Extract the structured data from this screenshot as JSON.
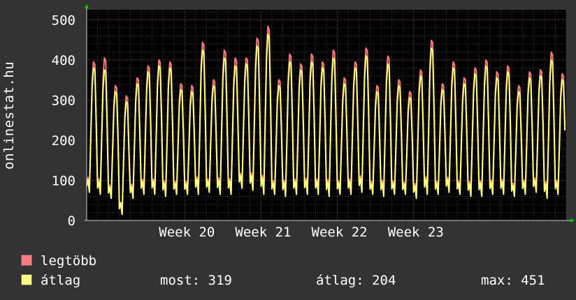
{
  "colors": {
    "background": "#333333",
    "canvas": "#000000",
    "grid_minor": "#3a3a3a",
    "grid_major": "#5a2a2a",
    "arrow": "#00cc00",
    "text": "#ffffff"
  },
  "vertical_label": "onlinestat.hu",
  "chart_data": {
    "type": "line",
    "title": "",
    "xlabel": "",
    "ylabel": "onlinestat.hu",
    "ylim": [
      0,
      525
    ],
    "yticks": [
      0,
      100,
      200,
      300,
      400,
      500
    ],
    "xticks": [
      "Week 20",
      "Week 21",
      "Week 22",
      "Week 23"
    ],
    "grid": true,
    "legend_position": "bottom-left",
    "sampling": "daily cycle, ~4 samples per day, 44 days shown",
    "series": [
      {
        "name": "legtöbb",
        "color": "#ff7b7b",
        "daily_peaks": [
          400,
          410,
          340,
          315,
          360,
          390,
          405,
          400,
          345,
          340,
          450,
          355,
          430,
          410,
          410,
          460,
          490,
          355,
          420,
          395,
          420,
          400,
          430,
          360,
          400,
          435,
          340,
          415,
          355,
          325,
          380,
          455,
          345,
          400,
          360,
          385,
          405,
          375,
          390,
          340,
          375,
          380,
          425,
          370
        ],
        "daily_troughs": [
          75,
          70,
          60,
          15,
          60,
          70,
          70,
          65,
          70,
          70,
          70,
          75,
          70,
          70,
          85,
          80,
          70,
          70,
          65,
          70,
          70,
          70,
          65,
          70,
          70,
          75,
          70,
          65,
          70,
          70,
          60,
          70,
          70,
          75,
          70,
          65,
          65,
          70,
          70,
          65,
          70,
          75,
          60,
          70
        ]
      },
      {
        "name": "átlag",
        "color": "#ffff7b",
        "daily_peaks": [
          385,
          380,
          325,
          300,
          345,
          375,
          390,
          385,
          330,
          325,
          430,
          340,
          410,
          390,
          395,
          440,
          470,
          340,
          400,
          380,
          400,
          385,
          410,
          345,
          385,
          415,
          325,
          395,
          340,
          310,
          365,
          435,
          330,
          385,
          345,
          370,
          390,
          360,
          375,
          325,
          360,
          365,
          405,
          355
        ],
        "daily_troughs": [
          70,
          65,
          55,
          15,
          55,
          65,
          65,
          60,
          65,
          65,
          65,
          70,
          65,
          65,
          80,
          75,
          65,
          65,
          60,
          65,
          65,
          65,
          60,
          65,
          65,
          70,
          65,
          60,
          65,
          65,
          55,
          65,
          65,
          70,
          65,
          60,
          60,
          65,
          65,
          60,
          65,
          70,
          55,
          65
        ]
      }
    ]
  },
  "legend": [
    {
      "label": "legtöbb",
      "color": "#ff7b7b"
    },
    {
      "label": "átlag",
      "color": "#ffff7b"
    }
  ],
  "stats": {
    "most": "most: 319",
    "atlag": "átlag: 204",
    "max": "max: 451"
  }
}
